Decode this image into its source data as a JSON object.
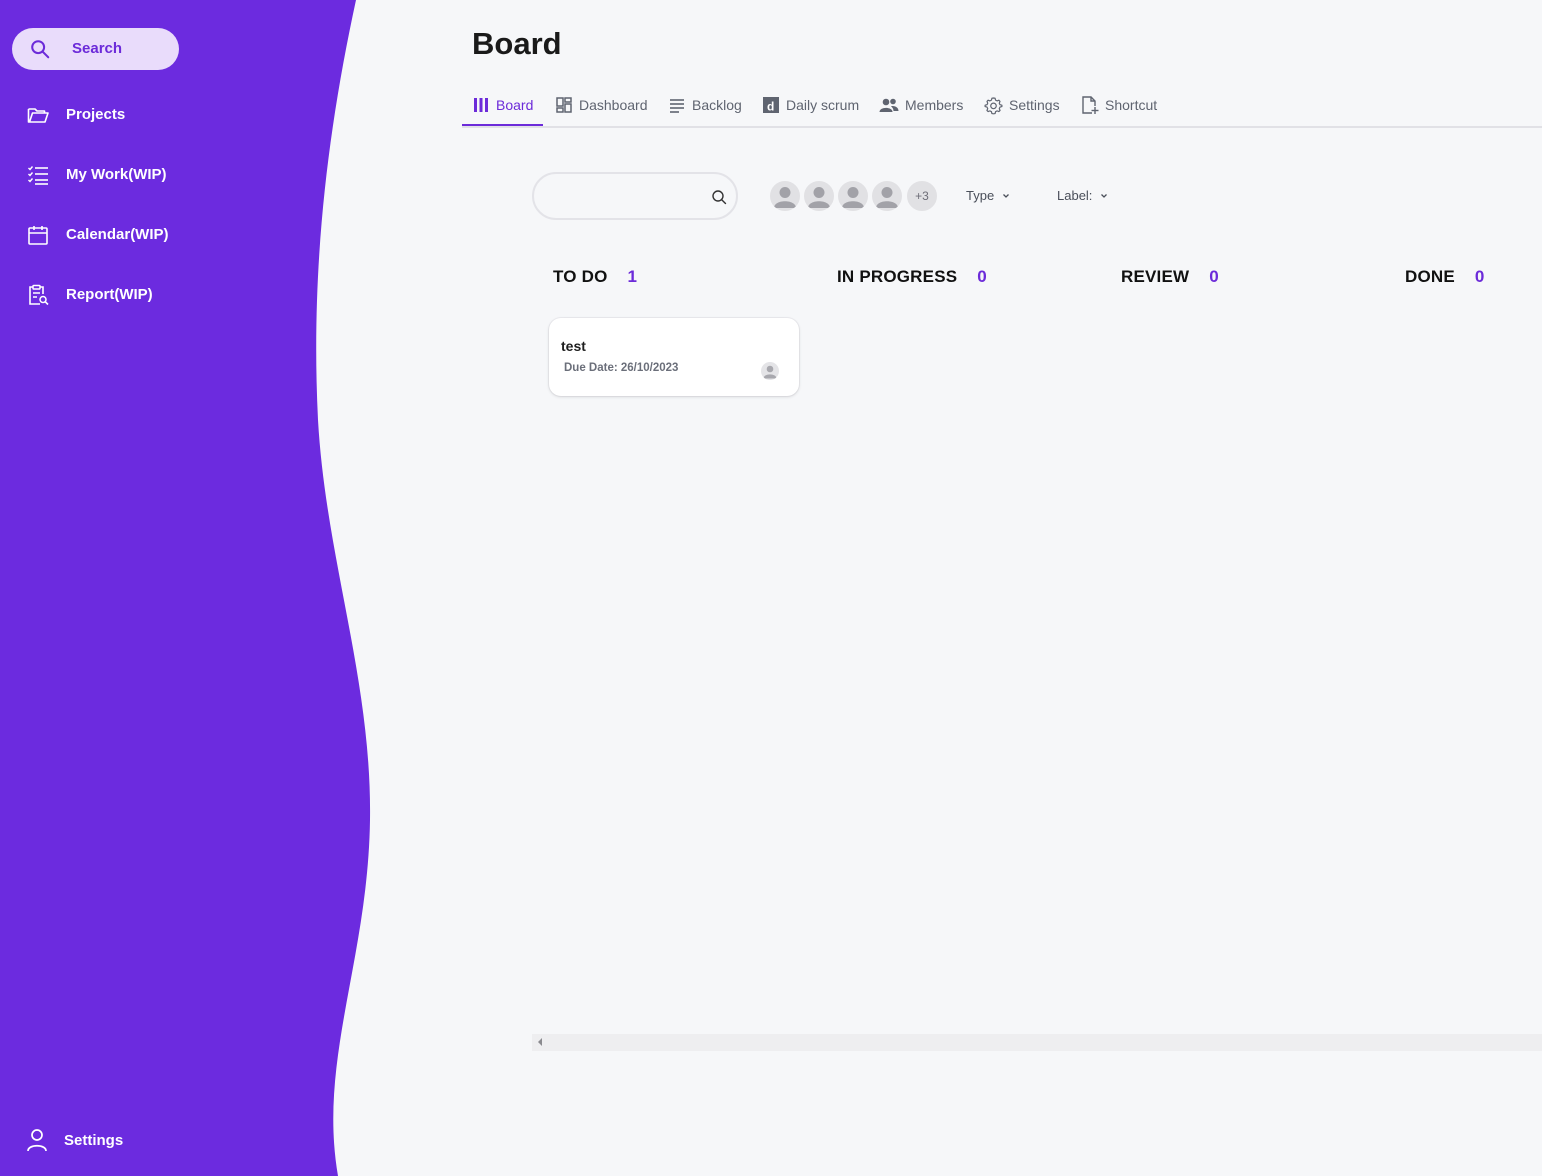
{
  "sidebar": {
    "search_label": "Search",
    "items": [
      {
        "label": "Projects",
        "icon": "folder-open-icon"
      },
      {
        "label": "My Work(WIP)",
        "icon": "checklist-icon"
      },
      {
        "label": "Calendar(WIP)",
        "icon": "calendar-icon"
      },
      {
        "label": "Report(WIP)",
        "icon": "report-search-icon"
      }
    ],
    "settings_label": "Settings",
    "accent_color": "#6c2bdf"
  },
  "page": {
    "title": "Board"
  },
  "tabs": [
    {
      "label": "Board",
      "icon": "board-columns-icon",
      "active": true
    },
    {
      "label": "Dashboard",
      "icon": "dashboard-grid-icon"
    },
    {
      "label": "Backlog",
      "icon": "lines-icon"
    },
    {
      "label": "Daily scrum",
      "icon": "daily-d-icon"
    },
    {
      "label": "Members",
      "icon": "people-icon"
    },
    {
      "label": "Settings",
      "icon": "gear-icon"
    },
    {
      "label": "Shortcut",
      "icon": "file-plus-icon"
    }
  ],
  "filters": {
    "search_value": "",
    "more_members": "+3",
    "type_label": "Type",
    "label_label": "Label:"
  },
  "columns": [
    {
      "name": "TO DO",
      "count": "1"
    },
    {
      "name": "IN PROGRESS",
      "count": "0"
    },
    {
      "name": "REVIEW",
      "count": "0"
    },
    {
      "name": "DONE",
      "count": "0"
    }
  ],
  "cards": [
    {
      "title": "test",
      "due": "Due Date: 26/10/2023"
    }
  ]
}
